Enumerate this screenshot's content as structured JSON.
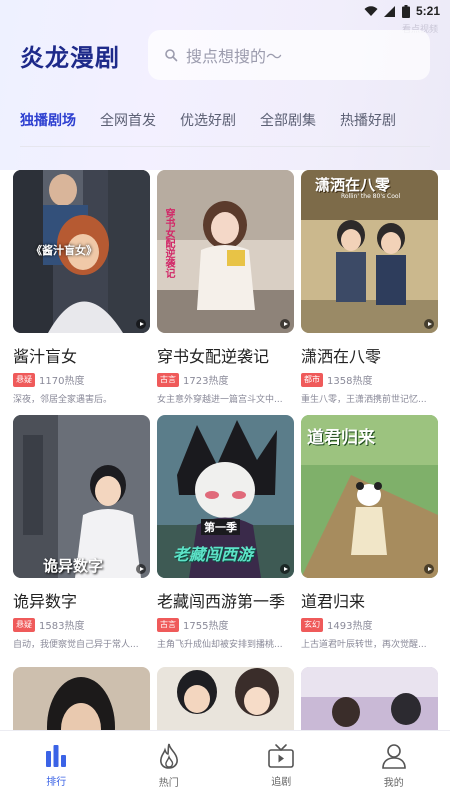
{
  "status": {
    "time": "5:21"
  },
  "faint_text": "看点视频",
  "header": {
    "title": "炎龙漫剧",
    "search_placeholder": "搜点想搜的～"
  },
  "tabs": [
    {
      "label": "独播剧场",
      "active": true
    },
    {
      "label": "全网首发",
      "active": false
    },
    {
      "label": "优选好剧",
      "active": false
    },
    {
      "label": "全部剧集",
      "active": false
    },
    {
      "label": "热播好剧",
      "active": false
    }
  ],
  "cards": [
    {
      "title": "酱汁盲女",
      "tag": "悬疑",
      "tag_color": "#ef5a5a",
      "heat": "1170热度",
      "desc": "深夜，邻居全家遇害后。",
      "cover_text": "《酱汁盲女》"
    },
    {
      "title": "穿书女配逆袭记",
      "tag": "古言",
      "tag_color": "#ef5a5a",
      "heat": "1723热度",
      "desc": "女主意外穿越进一篇宫斗文中...",
      "cover_text": "穿书女配逆袭记"
    },
    {
      "title": "潇洒在八零",
      "tag": "都市",
      "tag_color": "#ef5a5a",
      "heat": "1358热度",
      "desc": "重生八零，王潇洒携前世记忆...",
      "cover_text": "潇洒在八零",
      "cover_subtext": "Rollin' the 80's Cool"
    },
    {
      "title": "诡异数字",
      "tag": "悬疑",
      "tag_color": "#ef5a5a",
      "heat": "1583热度",
      "desc": "自动，我便察觉自己异于常人...",
      "cover_text": "诡异数字"
    },
    {
      "title": "老藏闯西游第一季",
      "tag": "古言",
      "tag_color": "#ef5a5a",
      "heat": "1755热度",
      "desc": "主角飞升成仙却被安排到播桃...",
      "cover_text": "老藏闯西游",
      "cover_subtext": "第一季"
    },
    {
      "title": "道君归来",
      "tag": "玄幻",
      "tag_color": "#ef5a5a",
      "heat": "1493热度",
      "desc": "上古道君叶辰转世，再次觉醒...",
      "cover_text": "道君归来"
    }
  ],
  "nav": [
    {
      "label": "排行",
      "icon": "bar-chart-icon",
      "active": true
    },
    {
      "label": "热门",
      "icon": "flame-icon",
      "active": false
    },
    {
      "label": "追剧",
      "icon": "tv-icon",
      "active": false
    },
    {
      "label": "我的",
      "icon": "user-icon",
      "active": false
    }
  ],
  "colors": {
    "accent": "#2d3fd0",
    "nav_active": "#3b63e6",
    "tag": "#ef5a5a"
  }
}
